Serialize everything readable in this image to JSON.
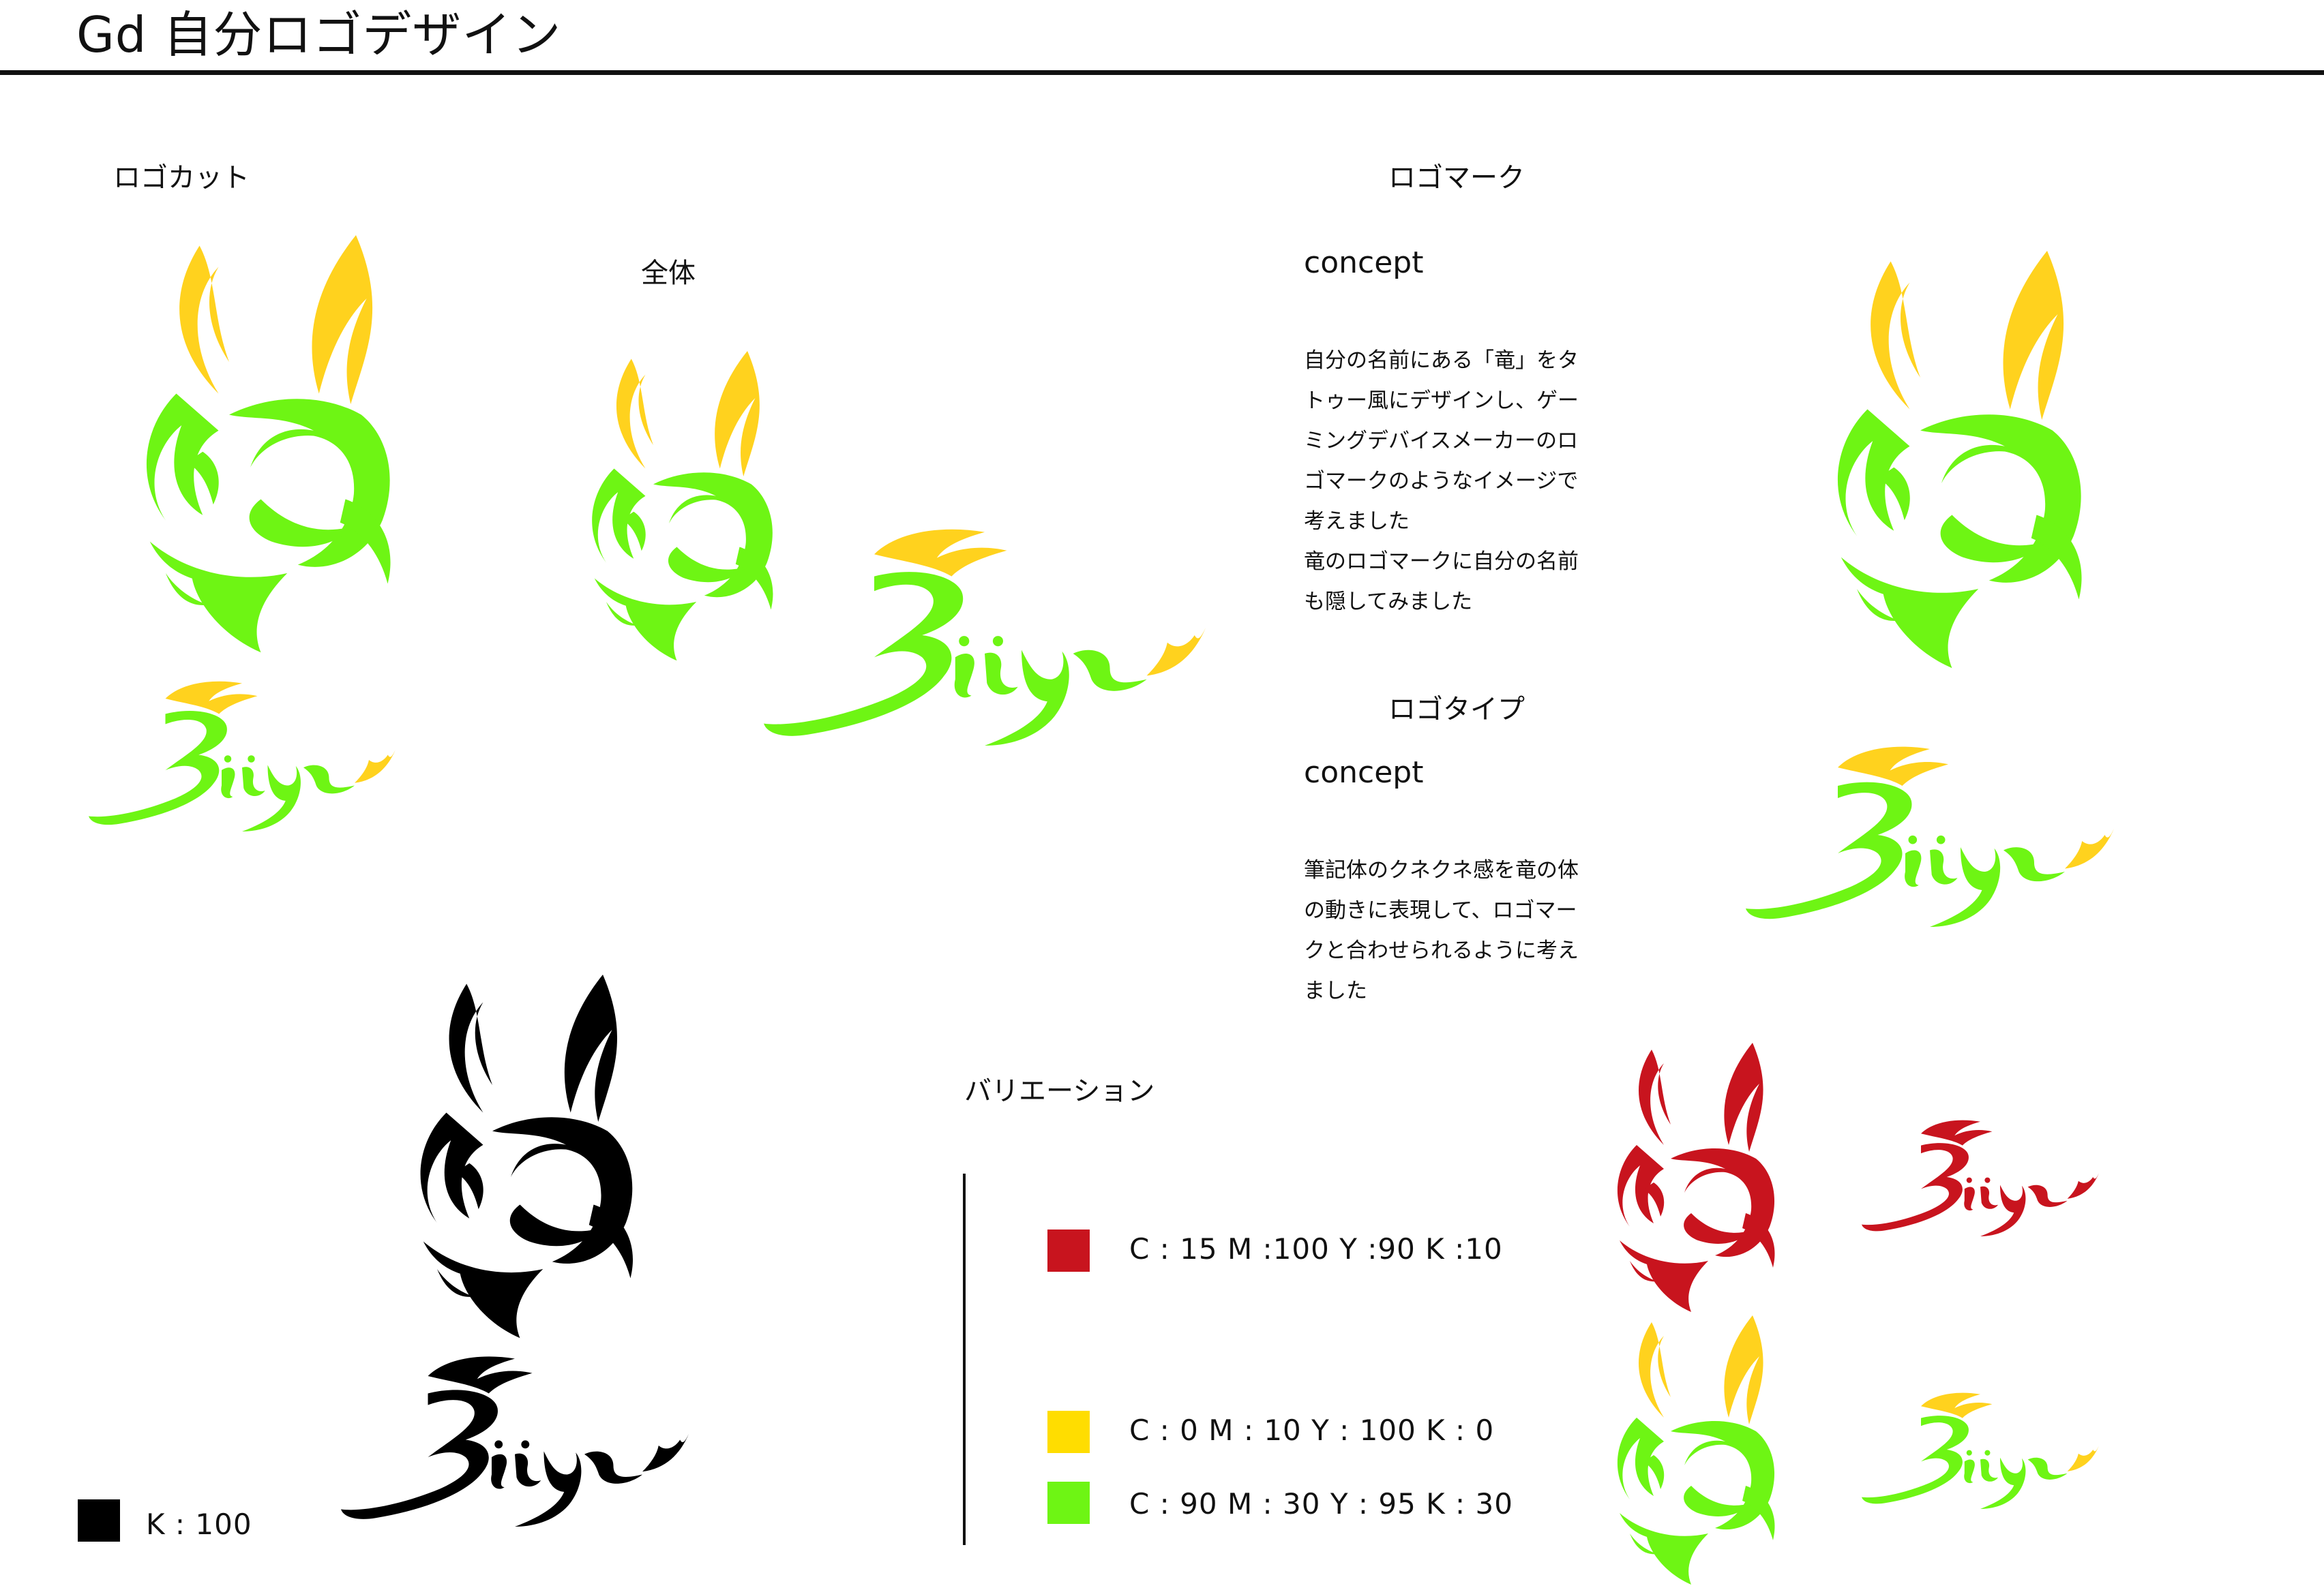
{
  "title": "Gd 自分ロゴデザイン",
  "sections": {
    "logo_cut": "ロゴカット",
    "whole": "全体",
    "logo_mark": "ロゴマーク",
    "logo_type": "ロゴタイプ",
    "variation": "バリエーション"
  },
  "mark_concept": {
    "heading": "concept",
    "lines": [
      "自分の名前にある「竜」をタ",
      "トゥー風にデザインし、ゲー",
      "ミングデバイスメーカーのロ",
      "ゴマークのようなイメージで",
      "考えました",
      "竜のロゴマークに自分の名前",
      "も隠してみました"
    ]
  },
  "type_concept": {
    "heading": "concept",
    "lines": [
      "筆記体のクネクネ感を竜の体",
      "の動きに表現して、ロゴマー",
      "クと合わせられるように考え",
      "ました"
    ]
  },
  "swatches": [
    {
      "label": "C : 15 M :100 Y :90 K :10",
      "color": "#c8141e"
    },
    {
      "label": "C : 0 M : 10 Y : 100 K : 0",
      "color": "#ffdd00"
    },
    {
      "label": "C : 90 M : 30 Y : 95 K : 30",
      "color": "#6ef514"
    },
    {
      "label": "K : 100",
      "color": "#000000"
    }
  ],
  "colors": {
    "green": "#6ef514",
    "yellow": "#ffd21e",
    "red": "#c8141e",
    "black": "#000000"
  },
  "artwork": {
    "dragon_head": "dragon-head-logo",
    "wordmark": "ryu-script-wordmark"
  }
}
